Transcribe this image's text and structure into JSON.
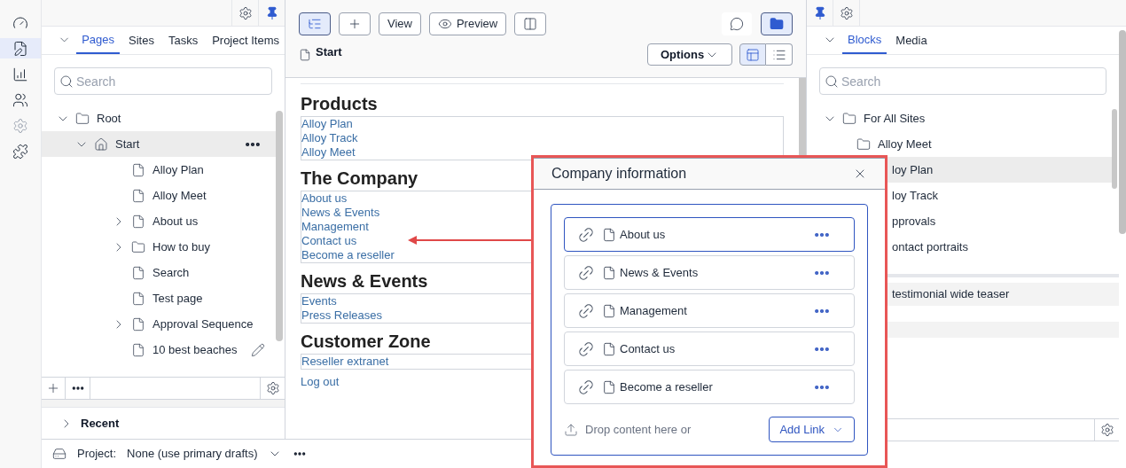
{
  "rail": {
    "items": [
      {
        "kind": "gauge",
        "selected": false
      },
      {
        "kind": "edit",
        "selected": true
      },
      {
        "kind": "chart",
        "selected": false
      },
      {
        "kind": "users",
        "selected": false
      },
      {
        "kind": "settings",
        "selected": false
      },
      {
        "kind": "addon",
        "selected": false
      }
    ]
  },
  "left_pane": {
    "tabs": [
      {
        "label": "Pages",
        "selected": true
      },
      {
        "label": "Sites",
        "selected": false
      },
      {
        "label": "Tasks",
        "selected": false
      },
      {
        "label": "Project Items",
        "selected": false
      }
    ],
    "search": {
      "placeholder": "Search"
    },
    "tree": [
      {
        "label": "Root",
        "kind": "folder",
        "expanded": true,
        "selected": false,
        "children": [
          {
            "label": "Start",
            "kind": "home",
            "expanded": true,
            "selected": true,
            "children": [
              {
                "label": "Alloy Plan",
                "kind": "page",
                "selected": false
              },
              {
                "label": "Alloy Meet",
                "kind": "page",
                "selected": false
              },
              {
                "label": "About us",
                "kind": "page",
                "expanded": false,
                "selected": false
              },
              {
                "label": "How to buy",
                "kind": "folder",
                "expanded": false,
                "selected": false
              },
              {
                "label": "Search",
                "kind": "page",
                "selected": false
              },
              {
                "label": "Test page",
                "kind": "page",
                "selected": false
              },
              {
                "label": "Approval Sequence",
                "kind": "page",
                "expanded": false,
                "selected": false
              },
              {
                "label": "10 best beaches",
                "kind": "page",
                "selected": false,
                "editing": true
              }
            ]
          }
        ]
      }
    ],
    "recent": {
      "label": "Recent",
      "expanded": false
    }
  },
  "center": {
    "toolbar": [
      {
        "kind": "tree",
        "selected": true
      },
      {
        "kind": "add",
        "selected": false
      },
      {
        "kind": "text",
        "label": "View",
        "selected": false
      },
      {
        "kind": "preview",
        "label": "Preview",
        "selected": false
      },
      {
        "kind": "compare",
        "selected": false
      }
    ],
    "toolbar_right": [
      {
        "kind": "comment",
        "selected": false
      },
      {
        "kind": "folder",
        "selected": true
      }
    ],
    "page_title": "Start",
    "options": "Options",
    "view_toggles": [
      {
        "kind": "layout",
        "selected": true
      },
      {
        "kind": "list",
        "selected": false
      }
    ],
    "sections": [
      {
        "heading": "Products",
        "links": [
          "Alloy Plan",
          "Alloy Track",
          "Alloy Meet"
        ]
      },
      {
        "heading": "The Company",
        "links": [
          "About us",
          "News & Events",
          "Management",
          "Contact us",
          "Become a reseller"
        ]
      },
      {
        "heading": "News & Events",
        "links": [
          "Events",
          "Press Releases"
        ]
      },
      {
        "heading": "Customer Zone",
        "links": [
          "Reseller extranet"
        ],
        "extra_links": [
          "Log out"
        ]
      }
    ]
  },
  "right_pane": {
    "tabs": [
      {
        "label": "Blocks",
        "selected": true
      },
      {
        "label": "Media",
        "selected": false
      }
    ],
    "search": {
      "placeholder": "Search"
    },
    "tree": [
      {
        "label": "For All Sites",
        "kind": "folder",
        "expanded": true,
        "selected": false,
        "children": [
          {
            "label": "Alloy Meet",
            "kind": "folder",
            "selected": false
          },
          {
            "label": "loy Plan",
            "selected": true
          },
          {
            "label": "loy Track",
            "selected": false
          },
          {
            "label": "pprovals",
            "selected": false
          },
          {
            "label": "ontact portraits",
            "selected": false
          }
        ]
      }
    ],
    "lower_items": [
      "testimonial wide teaser"
    ]
  },
  "dialog": {
    "title": "Company information",
    "items": [
      {
        "label": "About us",
        "selected": true
      },
      {
        "label": "News & Events",
        "selected": false
      },
      {
        "label": "Management",
        "selected": false
      },
      {
        "label": "Contact us",
        "selected": false
      },
      {
        "label": "Become a reseller",
        "selected": false
      }
    ],
    "drop_text": "Drop content here or",
    "add_button": "Add Link"
  },
  "bottom_bar": {
    "project_label": "Project:",
    "project_value": "None (use primary drafts)"
  }
}
